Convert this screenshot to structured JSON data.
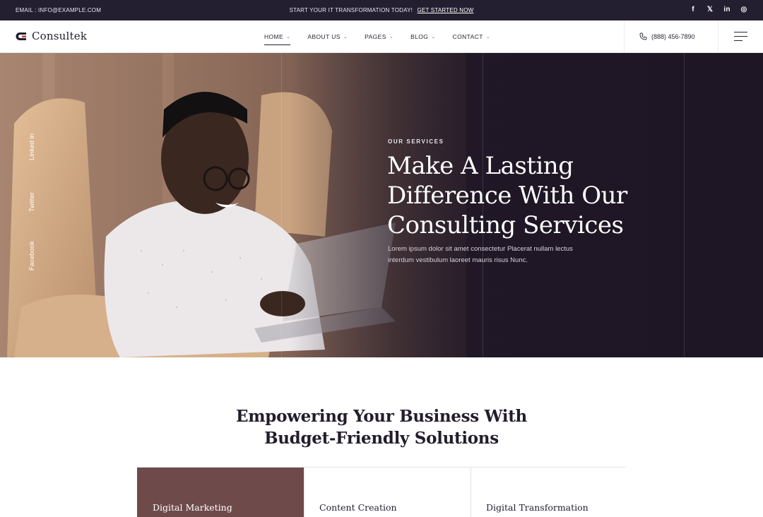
{
  "topbar": {
    "email": "EMAIL : INFO@EXAMPLE.COM",
    "promo_text": "START YOUR IT TRANSFORMATION TODAY!",
    "promo_link": "GET STARTED NOW",
    "socials": [
      {
        "icon": "facebook-icon",
        "glyph": "f"
      },
      {
        "icon": "x-icon",
        "glyph": "𝕏"
      },
      {
        "icon": "linkedin-icon",
        "glyph": "in"
      },
      {
        "icon": "instagram-icon",
        "glyph": "◎"
      }
    ]
  },
  "header": {
    "brand": "Consultek",
    "nav": [
      {
        "label": "HOME",
        "active": true
      },
      {
        "label": "ABOUT US",
        "active": false
      },
      {
        "label": "PAGES",
        "active": false
      },
      {
        "label": "BLOG",
        "active": false
      },
      {
        "label": "CONTACT",
        "active": false
      }
    ],
    "phone": "(888) 456-7890"
  },
  "hero": {
    "side_socials": [
      "Linked in",
      "Twitter",
      "Facebook"
    ],
    "eyebrow": "OUR SERVICES",
    "title_lines": [
      "Make A Lasting",
      "Difference With Our",
      "Consulting Services"
    ],
    "description": "Lorem ipsum dolor sit amet consectetur Placerat nullam lectus interdum vestibulum laoreet mauris risus Nunc."
  },
  "section": {
    "title_lines": [
      "Empowering Your Business With",
      "Budget-Friendly Solutions"
    ],
    "cards": [
      {
        "label": "Digital Marketing",
        "active": true
      },
      {
        "label": "Content Creation",
        "active": false
      },
      {
        "label": "Digital Transformation",
        "active": false
      }
    ]
  },
  "colors": {
    "topbar_bg": "#241f30",
    "accent_card": "#6e4a4a",
    "hero_dark": "#1e1826"
  }
}
